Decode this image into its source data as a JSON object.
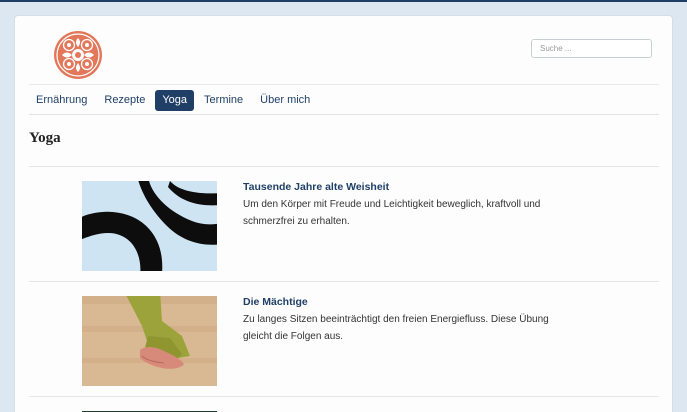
{
  "header": {
    "logo_name": "flower-ornament-logo",
    "search": {
      "placeholder": "Suche ..."
    }
  },
  "nav": {
    "items": [
      {
        "label": "Ernährung",
        "active": false
      },
      {
        "label": "Rezepte",
        "active": false
      },
      {
        "label": "Yoga",
        "active": true
      },
      {
        "label": "Termine",
        "active": false
      },
      {
        "label": "Über mich",
        "active": false
      }
    ]
  },
  "main": {
    "title": "Yoga",
    "articles": [
      {
        "title": "Tausende Jahre alte Weisheit",
        "text": "Um den Körper mit Freude und Leichtigkeit beweglich, kraftvoll und schmerzfrei zu erhalten."
      },
      {
        "title": "Die Mächtige",
        "text": "Zu langes Sitzen beeinträchtigt den freien Energiefluss. Diese Übung gleicht die Folgen aus."
      }
    ]
  },
  "colors": {
    "accent": "#1f3f66",
    "background": "#dce7f2",
    "logo": "#e2775a"
  }
}
